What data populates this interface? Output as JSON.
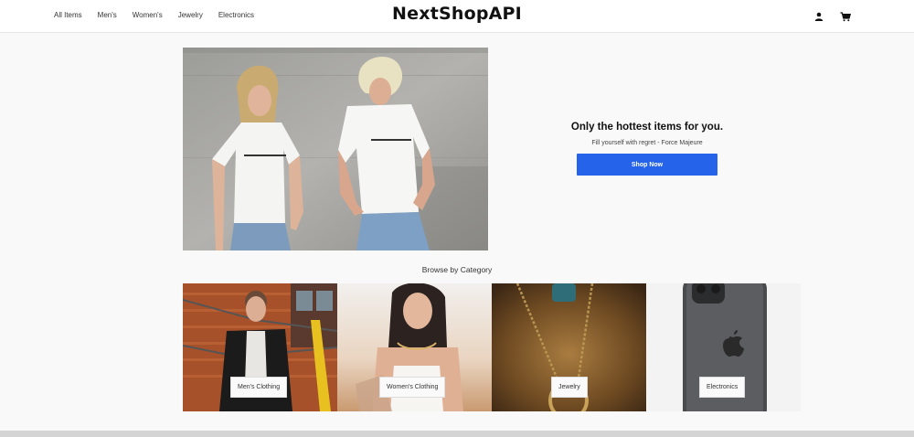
{
  "header": {
    "nav": [
      {
        "label": "All Items"
      },
      {
        "label": "Men's"
      },
      {
        "label": "Women's"
      },
      {
        "label": "Jewelry"
      },
      {
        "label": "Electronics"
      }
    ],
    "brand": "NextShopAPI",
    "icons": {
      "account": "user-icon",
      "cart": "cart-icon"
    }
  },
  "hero": {
    "title": "Only the hottest items for you.",
    "subtitle": "Fill yourself with regret - Force Majeure",
    "cta": "Shop Now",
    "shirt_text": "FORCE MAJEURE",
    "accent": "#2563eb"
  },
  "browse": {
    "title": "Browse by Category",
    "categories": [
      {
        "label": "Men's Clothing"
      },
      {
        "label": "Women's Clothing"
      },
      {
        "label": "Jewelry"
      },
      {
        "label": "Electronics"
      }
    ]
  }
}
